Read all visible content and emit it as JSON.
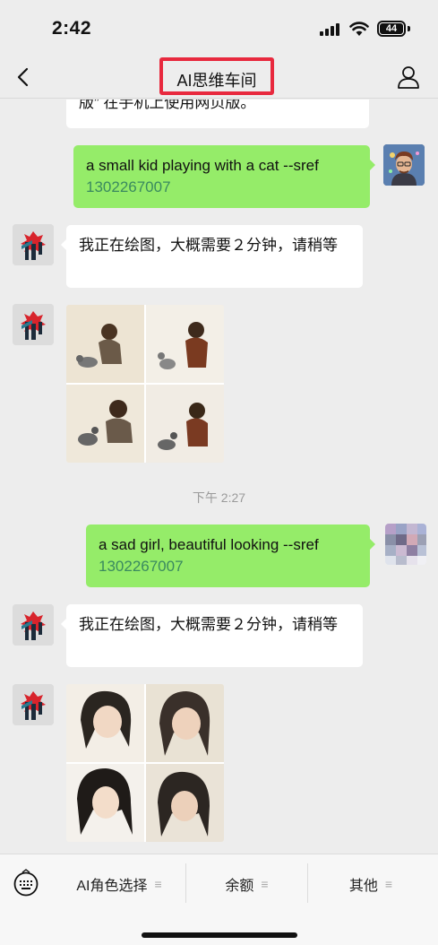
{
  "status_bar": {
    "time": "2:42",
    "battery": "44"
  },
  "nav": {
    "title": "AI思维车间"
  },
  "messages": {
    "m0": {
      "text": "版” 在手机上使用网页版。"
    },
    "m1": {
      "text": "a small kid playing with a cat --sref",
      "number": "1302267007"
    },
    "m2": {
      "text": "我正在绘图，大概需要２分钟，请稍等"
    },
    "timestamp": "下午 2:27",
    "m4": {
      "text": "a sad girl, beautiful looking --sref",
      "number": "1302267007"
    },
    "m5": {
      "text": "我正在绘图，大概需要２分钟，请稍等"
    }
  },
  "menu": {
    "items": [
      {
        "label": "AI角色选择",
        "icon": "≡"
      },
      {
        "label": "余额",
        "icon": "≡"
      },
      {
        "label": "其他",
        "icon": "≡"
      }
    ]
  },
  "colors": {
    "accent_red": "#e8293e",
    "bubble_green": "#95ec69",
    "number_green": "#3a8a5f"
  }
}
